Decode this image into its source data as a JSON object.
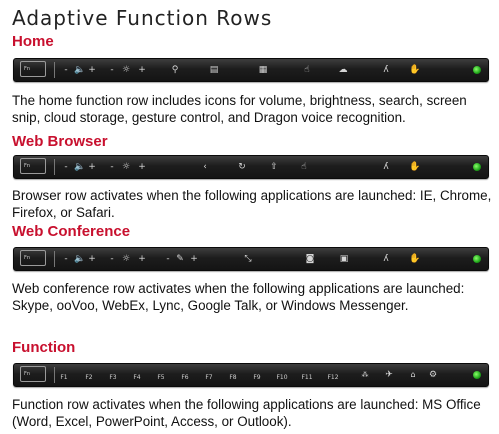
{
  "title": "Adaptive Function Rows",
  "sections": [
    {
      "heading": "Home",
      "description": "The home function row includes icons for volume, brightness, search, screen snip, cloud storage, gesture control, and Dragon voice recognition.",
      "icons": [
        "fn-lock-icon",
        "volume-down-icon",
        "speaker-icon",
        "volume-up-icon",
        "brightness-down-icon",
        "brightness-icon",
        "brightness-up-icon",
        "search-icon",
        "keyboard-icon",
        "screen-snip-icon",
        "gesture-icon",
        "cloud-icon",
        "dragon-voice-icon",
        "hand-icon"
      ]
    },
    {
      "heading": "Web Browser",
      "description": "Browser row activates when the following applications are launched: IE, Chrome, Firefox, or Safari.",
      "icons": [
        "fn-lock-icon",
        "volume-down-icon",
        "speaker-icon",
        "volume-up-icon",
        "brightness-down-icon",
        "brightness-icon",
        "brightness-up-icon",
        "back-icon",
        "refresh-icon",
        "share-icon",
        "gesture-icon",
        "dragon-voice-icon",
        "hand-icon"
      ]
    },
    {
      "heading": "Web Conference",
      "description": "Web conference row activates when the following applications are launched: Skype, ooVoo, WebEx, Lync, Google Talk, or Windows Messenger.",
      "icons": [
        "fn-lock-icon",
        "volume-down-icon",
        "speaker-icon",
        "volume-up-icon",
        "brightness-down-icon",
        "brightness-icon",
        "brightness-up-icon",
        "pen-minus-icon",
        "pen-plus-icon",
        "pen-size-icon",
        "camera-icon",
        "presentation-icon",
        "dragon-voice-icon",
        "hand-icon"
      ]
    },
    {
      "heading": "Function",
      "description": "Function row activates when the following applications are launched: MS Office (Word, Excel, PowerPoint, Access, or Outlook).",
      "fkeys": [
        "F1",
        "F2",
        "F3",
        "F4",
        "F5",
        "F6",
        "F7",
        "F8",
        "F9",
        "F10",
        "F11",
        "F12"
      ],
      "icons": [
        "fn-lock-icon",
        "wireless-icon",
        "airplane-icon",
        "home-icon",
        "settings-icon"
      ]
    }
  ],
  "bar": {
    "fn_label": "Fn",
    "minus": "-",
    "plus": "+",
    "led_color": "#3bd22a"
  }
}
